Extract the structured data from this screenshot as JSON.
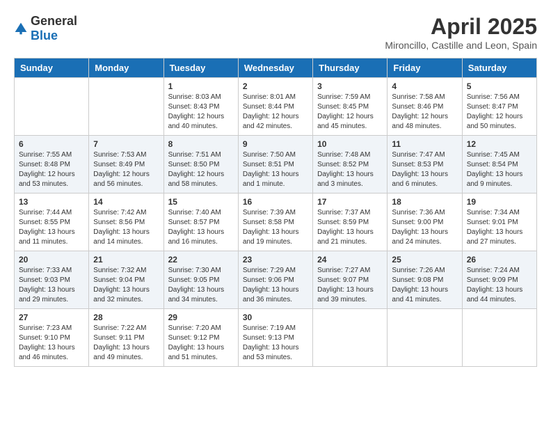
{
  "header": {
    "logo_general": "General",
    "logo_blue": "Blue",
    "month_title": "April 2025",
    "location": "Mironcillo, Castille and Leon, Spain"
  },
  "days_of_week": [
    "Sunday",
    "Monday",
    "Tuesday",
    "Wednesday",
    "Thursday",
    "Friday",
    "Saturday"
  ],
  "weeks": [
    [
      {
        "day": "",
        "info": ""
      },
      {
        "day": "",
        "info": ""
      },
      {
        "day": "1",
        "info": "Sunrise: 8:03 AM\nSunset: 8:43 PM\nDaylight: 12 hours and 40 minutes."
      },
      {
        "day": "2",
        "info": "Sunrise: 8:01 AM\nSunset: 8:44 PM\nDaylight: 12 hours and 42 minutes."
      },
      {
        "day": "3",
        "info": "Sunrise: 7:59 AM\nSunset: 8:45 PM\nDaylight: 12 hours and 45 minutes."
      },
      {
        "day": "4",
        "info": "Sunrise: 7:58 AM\nSunset: 8:46 PM\nDaylight: 12 hours and 48 minutes."
      },
      {
        "day": "5",
        "info": "Sunrise: 7:56 AM\nSunset: 8:47 PM\nDaylight: 12 hours and 50 minutes."
      }
    ],
    [
      {
        "day": "6",
        "info": "Sunrise: 7:55 AM\nSunset: 8:48 PM\nDaylight: 12 hours and 53 minutes."
      },
      {
        "day": "7",
        "info": "Sunrise: 7:53 AM\nSunset: 8:49 PM\nDaylight: 12 hours and 56 minutes."
      },
      {
        "day": "8",
        "info": "Sunrise: 7:51 AM\nSunset: 8:50 PM\nDaylight: 12 hours and 58 minutes."
      },
      {
        "day": "9",
        "info": "Sunrise: 7:50 AM\nSunset: 8:51 PM\nDaylight: 13 hours and 1 minute."
      },
      {
        "day": "10",
        "info": "Sunrise: 7:48 AM\nSunset: 8:52 PM\nDaylight: 13 hours and 3 minutes."
      },
      {
        "day": "11",
        "info": "Sunrise: 7:47 AM\nSunset: 8:53 PM\nDaylight: 13 hours and 6 minutes."
      },
      {
        "day": "12",
        "info": "Sunrise: 7:45 AM\nSunset: 8:54 PM\nDaylight: 13 hours and 9 minutes."
      }
    ],
    [
      {
        "day": "13",
        "info": "Sunrise: 7:44 AM\nSunset: 8:55 PM\nDaylight: 13 hours and 11 minutes."
      },
      {
        "day": "14",
        "info": "Sunrise: 7:42 AM\nSunset: 8:56 PM\nDaylight: 13 hours and 14 minutes."
      },
      {
        "day": "15",
        "info": "Sunrise: 7:40 AM\nSunset: 8:57 PM\nDaylight: 13 hours and 16 minutes."
      },
      {
        "day": "16",
        "info": "Sunrise: 7:39 AM\nSunset: 8:58 PM\nDaylight: 13 hours and 19 minutes."
      },
      {
        "day": "17",
        "info": "Sunrise: 7:37 AM\nSunset: 8:59 PM\nDaylight: 13 hours and 21 minutes."
      },
      {
        "day": "18",
        "info": "Sunrise: 7:36 AM\nSunset: 9:00 PM\nDaylight: 13 hours and 24 minutes."
      },
      {
        "day": "19",
        "info": "Sunrise: 7:34 AM\nSunset: 9:01 PM\nDaylight: 13 hours and 27 minutes."
      }
    ],
    [
      {
        "day": "20",
        "info": "Sunrise: 7:33 AM\nSunset: 9:03 PM\nDaylight: 13 hours and 29 minutes."
      },
      {
        "day": "21",
        "info": "Sunrise: 7:32 AM\nSunset: 9:04 PM\nDaylight: 13 hours and 32 minutes."
      },
      {
        "day": "22",
        "info": "Sunrise: 7:30 AM\nSunset: 9:05 PM\nDaylight: 13 hours and 34 minutes."
      },
      {
        "day": "23",
        "info": "Sunrise: 7:29 AM\nSunset: 9:06 PM\nDaylight: 13 hours and 36 minutes."
      },
      {
        "day": "24",
        "info": "Sunrise: 7:27 AM\nSunset: 9:07 PM\nDaylight: 13 hours and 39 minutes."
      },
      {
        "day": "25",
        "info": "Sunrise: 7:26 AM\nSunset: 9:08 PM\nDaylight: 13 hours and 41 minutes."
      },
      {
        "day": "26",
        "info": "Sunrise: 7:24 AM\nSunset: 9:09 PM\nDaylight: 13 hours and 44 minutes."
      }
    ],
    [
      {
        "day": "27",
        "info": "Sunrise: 7:23 AM\nSunset: 9:10 PM\nDaylight: 13 hours and 46 minutes."
      },
      {
        "day": "28",
        "info": "Sunrise: 7:22 AM\nSunset: 9:11 PM\nDaylight: 13 hours and 49 minutes."
      },
      {
        "day": "29",
        "info": "Sunrise: 7:20 AM\nSunset: 9:12 PM\nDaylight: 13 hours and 51 minutes."
      },
      {
        "day": "30",
        "info": "Sunrise: 7:19 AM\nSunset: 9:13 PM\nDaylight: 13 hours and 53 minutes."
      },
      {
        "day": "",
        "info": ""
      },
      {
        "day": "",
        "info": ""
      },
      {
        "day": "",
        "info": ""
      }
    ]
  ]
}
